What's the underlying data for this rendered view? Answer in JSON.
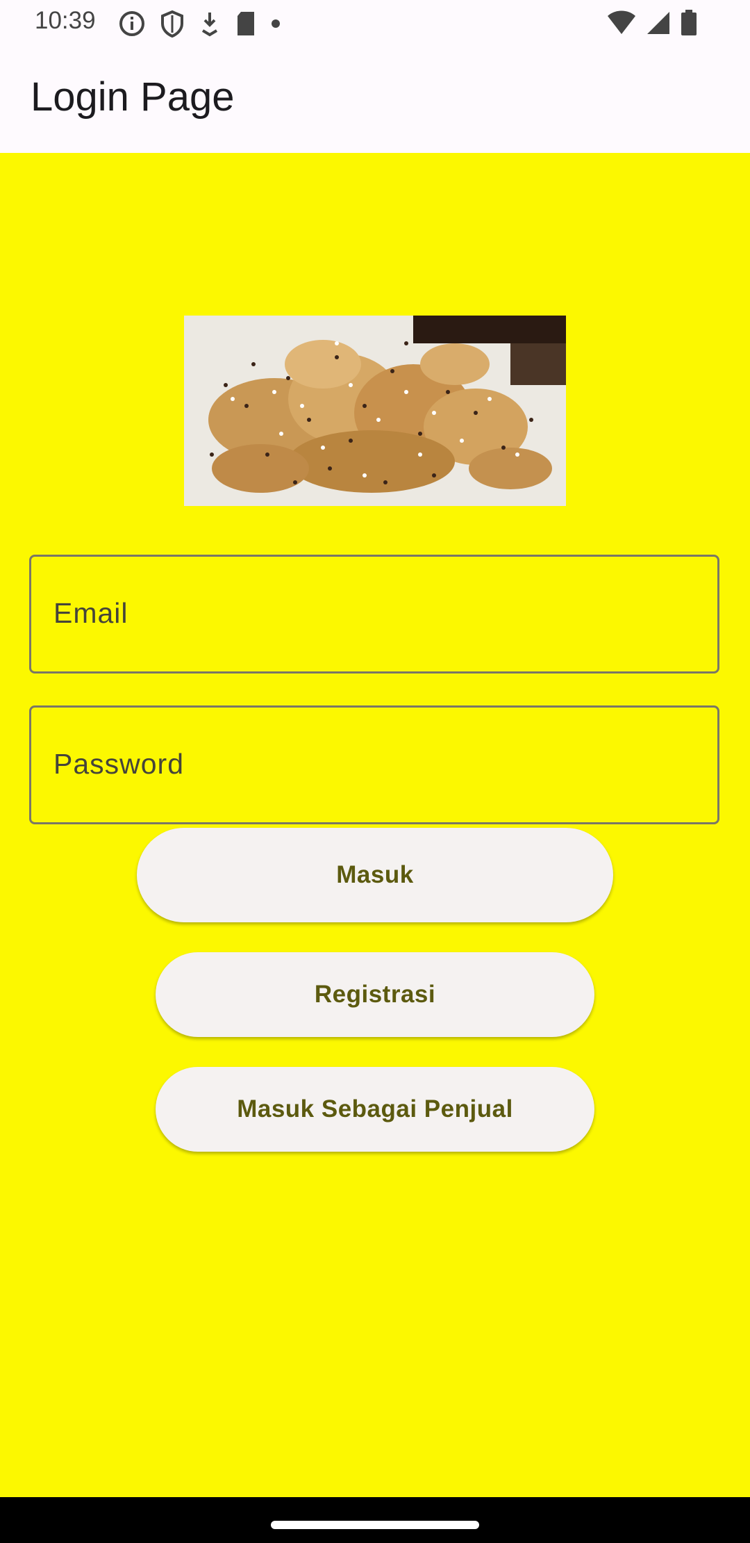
{
  "status_bar": {
    "time": "10:39",
    "left_icons": [
      "info-icon",
      "shield-icon",
      "download-icon",
      "sd-card-icon",
      "dot-icon"
    ],
    "right_icons": [
      "wifi-icon",
      "signal-icon",
      "battery-icon"
    ]
  },
  "app_bar": {
    "title": "Login Page"
  },
  "image": {
    "description_icon": "fried-banana-dessert-image"
  },
  "form": {
    "email_placeholder": "Email",
    "password_placeholder": "Password"
  },
  "buttons": {
    "login": "Masuk",
    "register": "Registrasi",
    "seller_login": "Masuk Sebagai Penjual"
  },
  "colors": {
    "background": "#fcf800",
    "button_bg": "#f5f2f1",
    "button_text": "#5c5a0f",
    "app_bar_bg": "#fefafe"
  }
}
